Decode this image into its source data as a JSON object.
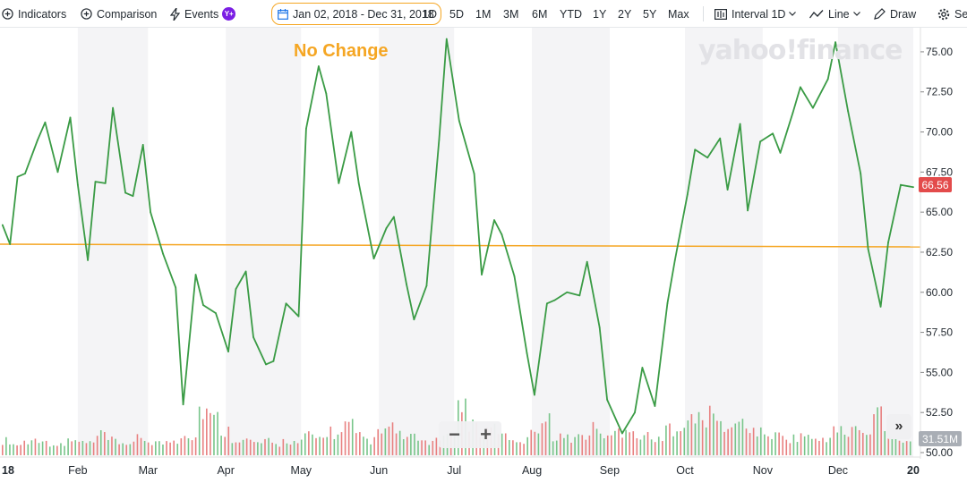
{
  "toolbar": {
    "indicators_label": "Indicators",
    "comparison_label": "Comparison",
    "events_label": "Events",
    "events_badge": "Y+",
    "date_range": "Jan 02, 2018 - Dec 31, 2018",
    "ranges": [
      "1D",
      "5D",
      "1M",
      "3M",
      "6M",
      "YTD",
      "1Y",
      "2Y",
      "5Y",
      "Max"
    ],
    "interval_label": "Interval",
    "interval_value": "1D",
    "chart_type_label": "Line",
    "draw_label": "Draw",
    "settings_label": "Se"
  },
  "annotation": "No Change",
  "watermark": "yahoo!finance",
  "zoom": {
    "minus": "−",
    "plus": "+"
  },
  "scroll_label": "»",
  "price_flag": "66.56",
  "volume_flag": "31.51M",
  "colors": {
    "price_line": "#3a9b45",
    "baseline": "#f5a623",
    "flag": "#e34b4b",
    "volume_up": "#78c58a",
    "volume_down": "#e88080",
    "shade": "#f4f4f6"
  },
  "chart_data": {
    "type": "line",
    "series": [
      {
        "x": [
          "2018-01-02",
          "2018-01-05",
          "2018-01-08",
          "2018-01-11",
          "2018-01-16",
          "2018-01-19",
          "2018-01-24",
          "2018-01-29",
          "2018-02-01",
          "2018-02-05",
          "2018-02-08",
          "2018-02-12",
          "2018-02-15",
          "2018-02-20",
          "2018-02-23",
          "2018-02-27",
          "2018-03-02",
          "2018-03-07",
          "2018-03-12",
          "2018-03-15",
          "2018-03-20",
          "2018-03-23",
          "2018-03-28",
          "2018-04-02",
          "2018-04-05",
          "2018-04-09",
          "2018-04-12",
          "2018-04-17",
          "2018-04-20",
          "2018-04-25",
          "2018-04-30",
          "2018-05-03",
          "2018-05-08",
          "2018-05-11",
          "2018-05-16",
          "2018-05-21",
          "2018-05-24",
          "2018-05-30",
          "2018-06-04",
          "2018-06-07",
          "2018-06-12",
          "2018-06-15",
          "2018-06-20",
          "2018-06-25",
          "2018-06-28",
          "2018-07-03",
          "2018-07-09",
          "2018-07-12",
          "2018-07-17",
          "2018-07-20",
          "2018-07-25",
          "2018-07-30",
          "2018-08-02",
          "2018-08-07",
          "2018-08-10",
          "2018-08-15",
          "2018-08-20",
          "2018-08-23",
          "2018-08-28",
          "2018-08-31",
          "2018-09-06",
          "2018-09-11",
          "2018-09-14",
          "2018-09-19",
          "2018-09-24",
          "2018-09-27",
          "2018-10-02",
          "2018-10-05",
          "2018-10-10",
          "2018-10-15",
          "2018-10-18",
          "2018-10-23",
          "2018-10-26",
          "2018-10-31",
          "2018-11-05",
          "2018-11-08",
          "2018-11-13",
          "2018-11-16",
          "2018-11-21",
          "2018-11-27",
          "2018-11-30",
          "2018-12-05",
          "2018-12-10",
          "2018-12-13",
          "2018-12-18",
          "2018-12-21",
          "2018-12-26",
          "2018-12-31"
        ],
        "y": [
          64.2,
          63.0,
          67.2,
          67.4,
          69.5,
          70.6,
          67.5,
          70.9,
          66.7,
          62.0,
          66.9,
          66.8,
          71.5,
          66.2,
          66.0,
          69.2,
          65.0,
          62.4,
          60.3,
          53.0,
          61.1,
          59.2,
          58.7,
          56.3,
          60.2,
          61.3,
          57.2,
          55.5,
          55.7,
          59.3,
          58.5,
          70.2,
          74.1,
          72.4,
          66.8,
          70.0,
          66.8,
          62.1,
          64.0,
          64.7,
          60.5,
          58.3,
          60.4,
          69.5,
          75.8,
          70.7,
          67.4,
          61.1,
          64.5,
          63.6,
          61.0,
          56.2,
          53.6,
          59.3,
          59.5,
          60.0,
          59.8,
          61.9,
          57.8,
          53.3,
          51.2,
          52.5,
          55.3,
          52.9,
          59.3,
          62.0,
          66.1,
          68.9,
          68.4,
          69.6,
          66.4,
          70.5,
          65.1,
          69.4,
          69.9,
          68.7,
          71.2,
          72.8,
          71.5,
          73.3,
          75.6,
          71.3,
          67.4,
          62.7,
          59.1,
          63.1,
          66.7,
          66.56
        ]
      }
    ],
    "baseline_value": 63.0,
    "ylim": [
      50.0,
      76.0
    ],
    "yticks": [
      "75.00",
      "72.50",
      "70.00",
      "67.50",
      "65.00",
      "62.50",
      "60.00",
      "57.50",
      "55.00",
      "52.50",
      "50.00"
    ],
    "ytick_values": [
      75.0,
      72.5,
      70.0,
      67.5,
      65.0,
      62.5,
      60.0,
      57.5,
      55.0,
      52.5,
      50.0
    ],
    "xlim": [
      "2018-01-01",
      "2018-12-31"
    ],
    "xticks": [
      "18",
      "Feb",
      "Mar",
      "Apr",
      "May",
      "Jun",
      "Jul",
      "Aug",
      "Sep",
      "Oct",
      "Nov",
      "Dec",
      "20"
    ],
    "xtick_dates": [
      "2018-01-01",
      "2018-02-01",
      "2018-03-01",
      "2018-04-01",
      "2018-05-01",
      "2018-06-01",
      "2018-07-01",
      "2018-08-01",
      "2018-09-01",
      "2018-10-01",
      "2018-11-01",
      "2018-12-01",
      "2018-12-31"
    ],
    "volume": {
      "max_label": "31.51M",
      "levels": [
        0.3,
        0.22,
        0.28,
        0.35,
        0.25,
        0.2,
        0.32,
        0.27,
        0.24,
        0.4,
        0.3,
        0.26,
        0.22,
        0.35,
        0.28,
        0.25,
        0.3,
        0.45,
        0.38,
        0.95,
        0.75,
        0.5,
        0.35,
        0.3,
        0.25,
        0.28,
        0.22,
        0.3,
        0.26,
        0.4,
        0.35,
        0.5,
        0.42,
        0.6,
        0.38,
        0.3,
        0.45,
        0.65,
        0.4,
        0.35,
        0.3,
        0.28,
        0.35,
        0.55,
        1.0,
        0.65,
        0.45,
        0.55,
        0.38,
        0.32,
        0.3,
        0.6,
        0.7,
        0.4,
        0.35,
        0.38,
        0.42,
        0.55,
        0.36,
        0.5,
        0.6,
        0.35,
        0.45,
        0.3,
        0.55,
        0.65,
        0.7,
        0.75,
        0.8,
        0.6,
        0.55,
        0.7,
        0.5,
        0.45,
        0.4,
        0.38,
        0.35,
        0.42,
        0.3,
        0.36,
        0.5,
        0.44,
        0.55,
        0.4,
        0.9,
        0.5,
        0.35,
        0.3
      ],
      "up": [
        1,
        0,
        1,
        1,
        1,
        1,
        0,
        1,
        0,
        0,
        1,
        0,
        1,
        0,
        0,
        1,
        0,
        0,
        0,
        0,
        1,
        0,
        0,
        0,
        1,
        1,
        0,
        0,
        1,
        1,
        0,
        1,
        1,
        0,
        0,
        1,
        0,
        0,
        1,
        1,
        0,
        0,
        1,
        1,
        1,
        0,
        0,
        0,
        1,
        0,
        0,
        0,
        0,
        1,
        1,
        1,
        0,
        1,
        0,
        0,
        0,
        1,
        1,
        0,
        1,
        1,
        1,
        1,
        0,
        1,
        0,
        1,
        0,
        1,
        1,
        0,
        1,
        1,
        0,
        1,
        1,
        0,
        0,
        0,
        0,
        1,
        1,
        0
      ]
    }
  }
}
